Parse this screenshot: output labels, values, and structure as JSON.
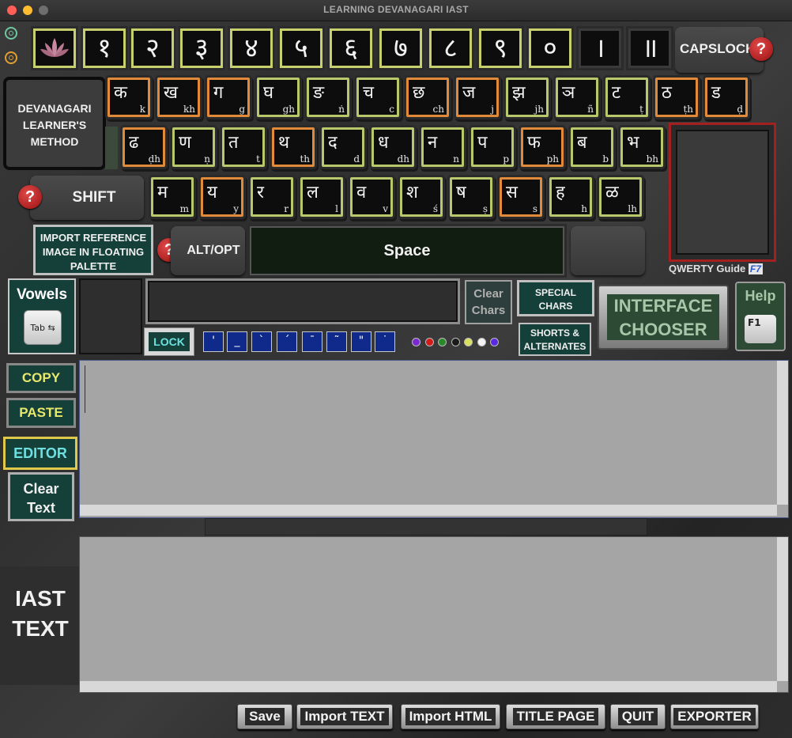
{
  "window": {
    "title": "LEARNING DEVANAGARI IAST"
  },
  "colors": {
    "close": "#ff5f57",
    "minimize": "#febc2e",
    "zoom": "#7a7a7a",
    "key_border": "#b8c86a",
    "key_border_alt": "#e08a3a"
  },
  "number_row": [
    "१",
    "२",
    "३",
    "४",
    "५",
    "६",
    "७",
    "८",
    "९",
    "०",
    "।",
    "॥"
  ],
  "capslock_label": "CAPSLOCK",
  "method_label": "DEVANAGARI LEARNER'S METHOD",
  "row1": [
    {
      "dv": "क",
      "iast": "k"
    },
    {
      "dv": "ख",
      "iast": "kh"
    },
    {
      "dv": "ग",
      "iast": "g"
    },
    {
      "dv": "घ",
      "iast": "gh"
    },
    {
      "dv": "ङ",
      "iast": "ṅ"
    },
    {
      "dv": "च",
      "iast": "c"
    },
    {
      "dv": "छ",
      "iast": "ch"
    },
    {
      "dv": "ज",
      "iast": "j"
    },
    {
      "dv": "झ",
      "iast": "jh"
    },
    {
      "dv": "ञ",
      "iast": "ñ"
    },
    {
      "dv": "ट",
      "iast": "ṭ"
    },
    {
      "dv": "ठ",
      "iast": "ṭh"
    },
    {
      "dv": "ड",
      "iast": "ḍ"
    }
  ],
  "row2": [
    {
      "dv": "ढ",
      "iast": "ḍh"
    },
    {
      "dv": "ण",
      "iast": "ṇ"
    },
    {
      "dv": "त",
      "iast": "t"
    },
    {
      "dv": "थ",
      "iast": "th"
    },
    {
      "dv": "द",
      "iast": "d"
    },
    {
      "dv": "ध",
      "iast": "dh"
    },
    {
      "dv": "न",
      "iast": "n"
    },
    {
      "dv": "प",
      "iast": "p"
    },
    {
      "dv": "फ",
      "iast": "ph"
    },
    {
      "dv": "ब",
      "iast": "b"
    },
    {
      "dv": "भ",
      "iast": "bh"
    }
  ],
  "row3": [
    {
      "dv": "म",
      "iast": "m"
    },
    {
      "dv": "य",
      "iast": "y"
    },
    {
      "dv": "र",
      "iast": "r"
    },
    {
      "dv": "ल",
      "iast": "l"
    },
    {
      "dv": "व",
      "iast": "v"
    },
    {
      "dv": "श",
      "iast": "ś"
    },
    {
      "dv": "ष",
      "iast": "ṣ"
    },
    {
      "dv": "स",
      "iast": "s"
    },
    {
      "dv": "ह",
      "iast": "h"
    },
    {
      "dv": "ळ",
      "iast": "lh"
    }
  ],
  "shift_label": "SHIFT",
  "import_ref_label": "IMPORT REFERENCE IMAGE IN FLOATING PALETTE",
  "alt_label": "ALT/OPT",
  "space_label": "Space",
  "qwerty_label": "QWERTY Guide",
  "qwerty_key": "F7",
  "vowels_label": "Vowels",
  "tab_key": "Tab",
  "clear_chars_label": "Clear Chars",
  "special_chars_label": "SPECIAL CHARS",
  "shorts_label": "SHORTS & ALTERNATES",
  "interface_chooser_label": "INTERFACE CHOOSER",
  "help_label": "Help",
  "help_key": "F1",
  "lock_label": "LOCK",
  "accents": [
    "'",
    "_",
    "`",
    "´",
    "¯",
    "˜",
    "\"",
    "˙"
  ],
  "dot_colors": [
    "#7a2ad0",
    "#d41a1a",
    "#2a8a2a",
    "#1a1a1a",
    "#d8e060",
    "#f4f4f4",
    "#5a2ae0"
  ],
  "copy_label": "COPY",
  "paste_label": "PASTE",
  "editor_label": "EDITOR",
  "clear_text_label": "Clear Text",
  "iast_text_label": "IAST TEXT",
  "bottom_buttons": [
    "Save",
    "Import TEXT",
    "Import HTML",
    "TITLE PAGE",
    "QUIT",
    "EXPORTER"
  ]
}
